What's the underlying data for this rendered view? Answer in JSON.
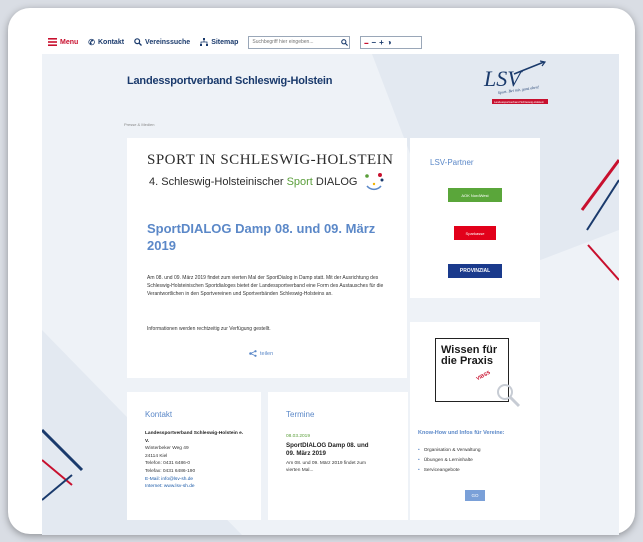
{
  "topbar": {
    "menu_label": "Menu",
    "contact_label": "Kontakt",
    "club_search_label": "Vereinssuche",
    "sitemap_label": "Sitemap",
    "search_placeholder": "Suchbegriff hier eingeben...",
    "contrast_minus": "−",
    "contrast_plus": "+"
  },
  "header": {
    "title": "Landessportverband Schleswig-Holstein",
    "logo_text": "LSV",
    "logo_slogan": "Sport. Bei mir, ganz oben!",
    "logo_subtext": "Landessportverband Schleswig-Holstein"
  },
  "breadcrumb": "Presse & Medien",
  "hero": {
    "title_line1": "SPORT IN SCHLESWIG-HOLSTEIN",
    "title_line2_prefix": "4. Schleswig-Holsteinischer",
    "title_line2_sport": "Sport",
    "title_line2_dialog": "DIALOG",
    "headline": "SportDIALOG Damp 08. und 09. März 2019",
    "body": "Am 08. und 09. März 2019 findet zum vierten Mal der SportDialog in Damp statt. Mit der Ausrichtung des Schleswig-Holsteinischen Sportdialoges bietet der Landessportverband eine Form des Austausches für die Verantwortlichen in den Sportvereinen und Sportverbänden Schleswig-Holsteins an.",
    "info": "Informationen werden rechtzeitig zur Verfügung gestellt.",
    "share_label": "teilen"
  },
  "partners": {
    "title": "LSV-Partner",
    "logos": [
      "AOK NordWest",
      "Sparkasse",
      "PROVINZIAL"
    ]
  },
  "knowhow": {
    "badge_title": "Wissen für die Praxis",
    "badge_sub": "VIBSS",
    "title": "Know-How und Infos für Vereine:",
    "items": [
      "Organisation & Verwaltung",
      "Übungen & Lerninhalte",
      "Serviceangebote"
    ],
    "go_label": "GO"
  },
  "contact": {
    "title": "Kontakt",
    "org": "Landessportverband Schleswig-Holstein e. V.",
    "street": "Winterbeker Weg 49",
    "city": "24114 Kiel",
    "phone": "Telefon: 0431 6486-0",
    "fax": "Telefax: 0431 6486-190",
    "email": "E-Mail: info@lsv-sh.de",
    "web": "Internet: www.lsv-sh.de"
  },
  "termine": {
    "title": "Termine",
    "date": "08.03.2019",
    "headline": "SportDIALOG Damp 08. und 09. März 2019",
    "body": "Am 08. und 09. März 2019 findet zum vierten Mal..."
  },
  "colors": {
    "brand_blue": "#1a3a6c",
    "accent_blue": "#5b88c8",
    "accent_red": "#c8102e",
    "accent_green": "#5a9e3a"
  }
}
